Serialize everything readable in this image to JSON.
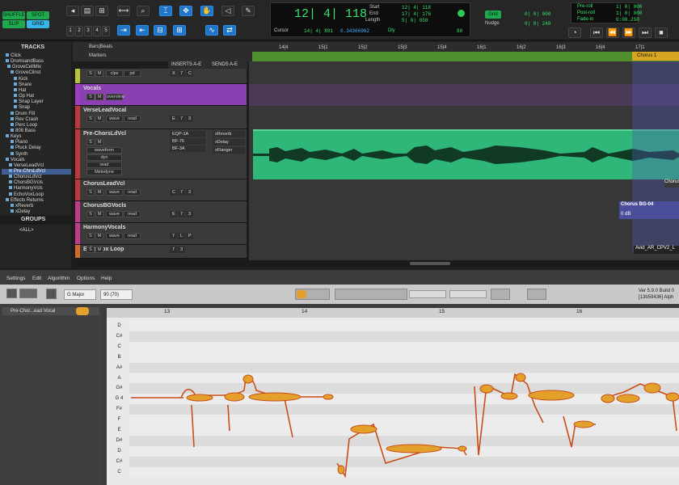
{
  "toolbar": {
    "modes": [
      "SHUFFLE",
      "SPOT",
      "SLIP",
      "GRID"
    ],
    "main_counter": "12| 4| 118",
    "start_label": "Start",
    "end_label": "End",
    "length_label": "Length",
    "start_val": "12| 4| 118",
    "end_val": "17| 4| 176",
    "length_val": "5| 0| 058",
    "cursor_label": "Cursor",
    "cursor_val": "14| 4| 891",
    "cursor_extra": "0.34366962",
    "dly_label": "Dly",
    "tempo_val": "80",
    "grid_label": "Grid",
    "grid_val": "0| 0| 000",
    "nudge_label": "Nudge",
    "nudge_val": "0| 0| 240",
    "preroll_label": "Pre-roll",
    "postroll_label": "Post-roll",
    "fadein_label": "Fade-in",
    "preroll_val": "1| 0| 000",
    "postroll_val": "1| 0| 000",
    "fadein_val": "0:00.250"
  },
  "tracks_panel": {
    "title": "TRACKS",
    "items": [
      "Click",
      "DrumsandBass",
      "GroveCellMix",
      "GroveClinst",
      "Kick",
      "Snare",
      "Hat",
      "Op Hat",
      "Snap Layer",
      "Snap",
      "Drum Fill",
      "Rev Crash",
      "Perc Loop",
      "808 Bass",
      "Keys",
      "Piano",
      "Pluck Delay",
      "Synth",
      "Vocals",
      "VerseLeadVcl",
      "Pre-ChrsLdVcl",
      "ChorusLdVcl",
      "ChorsBGVcls",
      "HarmonyVcls",
      "EchoVoxLoop",
      "Effects Returns",
      "xReverb",
      "xDelay"
    ],
    "selected_index": 20,
    "groups_title": "GROUPS",
    "groups_items": [
      "<ALL>"
    ]
  },
  "ruler": {
    "bars_beats": "Bars|Beats",
    "markers": "Markers",
    "ticks": [
      "14|4",
      "15|1",
      "15|2",
      "15|3",
      "15|4",
      "16|1",
      "16|2",
      "16|3",
      "16|4",
      "17|1"
    ],
    "marker_name": "Chorus 1"
  },
  "tracks_header": {
    "inserts": "INSERTS A-E",
    "sends": "SENDS A-E"
  },
  "tracks": [
    {
      "name": "",
      "mini": [
        "clps",
        "pd"
      ],
      "inserts": [
        "X",
        "7",
        "C"
      ],
      "sends": [],
      "color": "#b8c23a"
    },
    {
      "name": "Vocals",
      "mini": [
        "overview"
      ],
      "inserts": [],
      "sends": [],
      "color": "#9b3ec5"
    },
    {
      "name": "VerseLeadVocal",
      "mini": [
        "wave",
        "read"
      ],
      "inserts": [
        "E",
        "7",
        "3"
      ],
      "sends": [],
      "color": "#c2353a"
    },
    {
      "name": "Pre-ChorsLdVcl",
      "mini": [
        "waveform",
        "dyn",
        "read",
        "Melodyne"
      ],
      "inserts": [
        "EQP-1A",
        "BF-76",
        "BF-3A"
      ],
      "sends": [
        "xReverb",
        "xDelay",
        "xFlanger"
      ],
      "color": "#c2353a"
    },
    {
      "name": "ChorusLeadVcl",
      "mini": [
        "wave",
        "read"
      ],
      "inserts": [
        "C",
        "7",
        "3"
      ],
      "sends": [],
      "color": "#c2353a"
    },
    {
      "name": "ChorusBGVocls",
      "mini": [
        "wave",
        "read"
      ],
      "inserts": [
        "E",
        "7",
        "3"
      ],
      "sends": [],
      "color": "#c23a8a"
    },
    {
      "name": "HarmonyVocals",
      "mini": [
        "wave",
        "read"
      ],
      "inserts": [
        "7",
        "L",
        "P"
      ],
      "sends": [],
      "color": "#c23a8a"
    },
    {
      "name": "Echo Vox Loop",
      "mini": [],
      "inserts": [
        "7",
        "3"
      ],
      "sends": [],
      "color": "#d06a2a"
    }
  ],
  "clips": {
    "chorus_bg": "Chorus BG-04",
    "chorus_bg_db": "0 dB",
    "chorus_short": "Chorus",
    "avid": "Avid_AR_CPV2_L"
  },
  "melodyne": {
    "menu": [
      "Settings",
      "Edit",
      "Algorithm",
      "Options",
      "Help"
    ],
    "scale": "G Major",
    "tempo": "90 (70)",
    "version": "Ver 5.9.0 Build 0",
    "build": "[13b59436] Alph",
    "track_name": "Pre-Chor...ead Vocal",
    "bars": [
      "13",
      "14",
      "15",
      "16"
    ],
    "notes": [
      "D",
      "C#",
      "C",
      "B",
      "A#",
      "A",
      "G#",
      "G 4",
      "F#",
      "F",
      "E",
      "D#",
      "D",
      "C#",
      "C"
    ],
    "accent": "#e3a02a"
  }
}
